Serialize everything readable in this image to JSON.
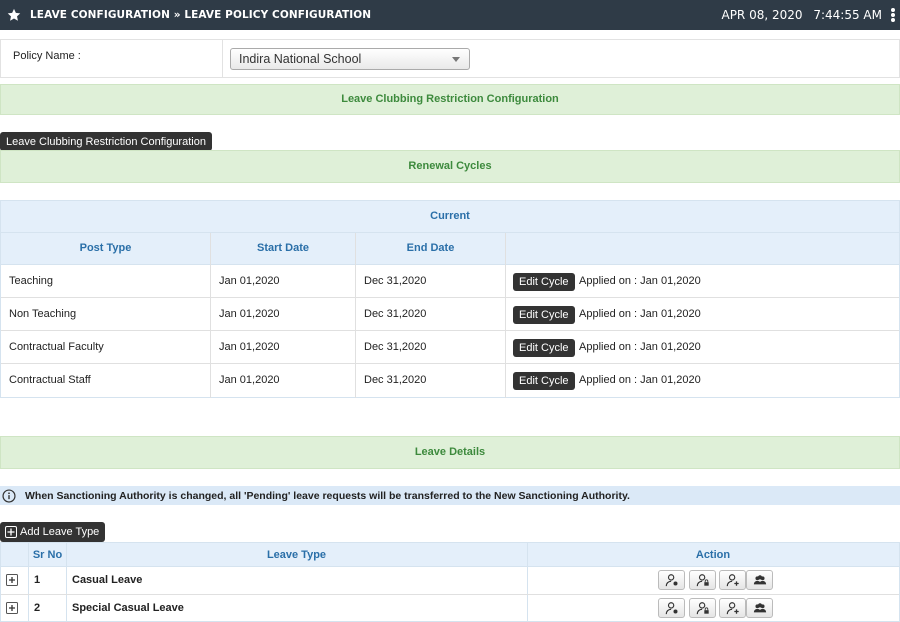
{
  "header": {
    "title": "LEAVE CONFIGURATION » LEAVE POLICY CONFIGURATION",
    "date": "APR 08, 2020",
    "time": "7:44:55 AM"
  },
  "policy": {
    "label": "Policy Name :",
    "selected": "Indira National School"
  },
  "bands": {
    "clubbing": "Leave Clubbing Restriction Configuration",
    "renewal": "Renewal Cycles",
    "leave_details": "Leave Details"
  },
  "buttons": {
    "clubbing": "Leave Clubbing Restriction Configuration",
    "add_leave_type": "Add Leave Type",
    "edit_cycle": "Edit Cycle"
  },
  "renewal_table": {
    "caption": "Current",
    "columns": [
      "Post Type",
      "Start Date",
      "End Date",
      ""
    ],
    "rows": [
      {
        "post_type": "Teaching",
        "start": "Jan 01,2020",
        "end": "Dec 31,2020",
        "applied": "Applied on : Jan 01,2020"
      },
      {
        "post_type": "Non Teaching",
        "start": "Jan 01,2020",
        "end": "Dec 31,2020",
        "applied": "Applied on : Jan 01,2020"
      },
      {
        "post_type": "Contractual Faculty",
        "start": "Jan 01,2020",
        "end": "Dec 31,2020",
        "applied": "Applied on : Jan 01,2020"
      },
      {
        "post_type": "Contractual Staff",
        "start": "Jan 01,2020",
        "end": "Dec 31,2020",
        "applied": "Applied on : Jan 01,2020"
      }
    ]
  },
  "info_message": "When Sanctioning Authority is changed, all 'Pending' leave requests will be transferred to the New Sanctioning Authority.",
  "leave_table": {
    "columns": [
      "",
      "Sr No",
      "Leave Type",
      "Action"
    ],
    "rows": [
      {
        "sr": "1",
        "type": "Casual Leave"
      },
      {
        "sr": "2",
        "type": "Special Casual Leave"
      }
    ]
  },
  "colors": {
    "topbar": "#2f3b47",
    "green_band": "#dff0d8",
    "green_text": "#3d8a3d",
    "blue_header": "#e4effa",
    "blue_text": "#2a6fa8"
  }
}
